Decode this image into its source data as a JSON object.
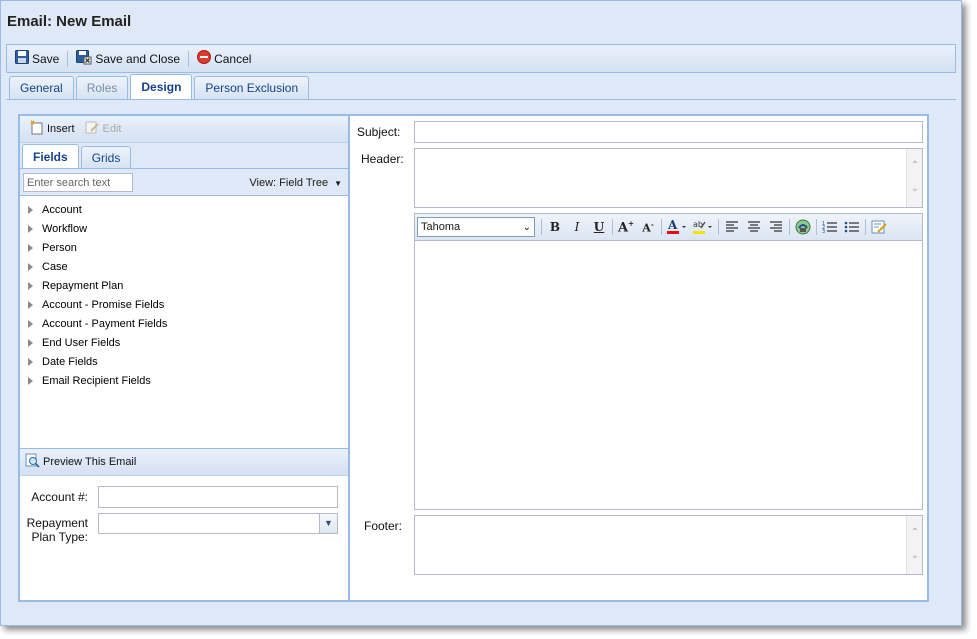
{
  "window": {
    "title": "Email: New Email"
  },
  "toolbar": {
    "save": "Save",
    "save_close": "Save and Close",
    "cancel": "Cancel"
  },
  "tabs": [
    {
      "label": "General",
      "state": "normal"
    },
    {
      "label": "Roles",
      "state": "disabled"
    },
    {
      "label": "Design",
      "state": "active"
    },
    {
      "label": "Person Exclusion",
      "state": "normal"
    }
  ],
  "left": {
    "insert": "Insert",
    "edit": "Edit",
    "subtabs": [
      "Fields",
      "Grids"
    ],
    "search_placeholder": "Enter search text",
    "view": "View: Field Tree",
    "tree": [
      "Account",
      "Workflow",
      "Person",
      "Case",
      "Repayment Plan",
      "Account - Promise Fields",
      "Account - Payment Fields",
      "End User Fields",
      "Date Fields",
      "Email Recipient Fields"
    ],
    "preview": "Preview This Email",
    "account_label": "Account #:",
    "plan_label_1": "Repayment",
    "plan_label_2": "Plan Type:"
  },
  "right": {
    "subject": "Subject:",
    "header": "Header:",
    "footer": "Footer:",
    "font": "Tahoma"
  },
  "colors": {
    "accent": "#15428b",
    "border": "#99bbe8",
    "panel": "#dfe8f6"
  }
}
